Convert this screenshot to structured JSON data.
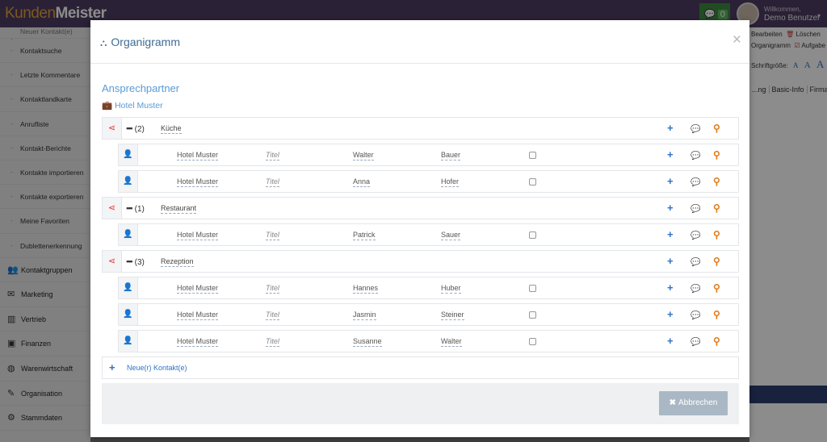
{
  "app": {
    "logo_a": "Kunden",
    "logo_b": "Meister",
    "chat_count": "0",
    "welcome": "Willkommen,",
    "user": "Demo Benutzer",
    "caret": "▾"
  },
  "sidebar": {
    "cut_item": "Neuer Kontakt(e)",
    "sub_items": [
      {
        "label": "Kontaktsuche"
      },
      {
        "label": "Letzte Kommentare"
      },
      {
        "label": "Kontaktlandkarte"
      },
      {
        "label": "Anrufliste"
      },
      {
        "label": "Kontakt-Berichte"
      },
      {
        "label": "Kontakte importieren"
      },
      {
        "label": "Kontakte exportieren"
      },
      {
        "label": "Meine Favoriten"
      },
      {
        "label": "Dublettenerkennung"
      }
    ],
    "main_items": [
      {
        "label": "Kontaktgruppen",
        "icon": "users-icon",
        "glyph": "👥"
      },
      {
        "label": "Marketing",
        "icon": "envelope-icon",
        "glyph": "✉"
      },
      {
        "label": "Vertrieb",
        "icon": "bar-chart-icon",
        "glyph": "▥"
      },
      {
        "label": "Finanzen",
        "icon": "money-icon",
        "glyph": "▣"
      },
      {
        "label": "Warenwirtschaft",
        "icon": "globe-icon",
        "glyph": "◍"
      },
      {
        "label": "Organisation",
        "icon": "edit-icon",
        "glyph": "✎"
      },
      {
        "label": "Stammdaten",
        "icon": "cogs-icon",
        "glyph": "⚙"
      }
    ]
  },
  "right_panel": {
    "bearbeiten": "Bearbeiten",
    "loeschen": "Löschen",
    "organigramm": "Organigramm",
    "aufgaben": "Aufgabe",
    "schriftgroesse": "Schriftgröße:",
    "font_sizes": [
      "A",
      "A",
      "A"
    ],
    "tabs": [
      "...ng",
      "Basic-Info",
      "Firma"
    ]
  },
  "modal": {
    "title": "Organigramm",
    "title_icon": "sitemap-icon",
    "close": "×",
    "section_title": "Ansprechpartner",
    "company": "Hotel Muster",
    "company_icon": "briefcase-icon",
    "new_contact": "Neue(r) Kontakt(e)",
    "cancel": "Abbrechen",
    "groups": [
      {
        "count": "(2)",
        "name": "Küche",
        "contacts": [
          {
            "company": "Hotel Muster",
            "title": "Titel",
            "first": "Walter",
            "last": "Bauer"
          },
          {
            "company": "Hotel Muster",
            "title": "Titel",
            "first": "Anna",
            "last": "Hofer"
          }
        ]
      },
      {
        "count": "(1)",
        "name": "Restaurant",
        "contacts": [
          {
            "company": "Hotel Muster",
            "title": "Titel",
            "first": "Patrick",
            "last": "Sauer"
          }
        ]
      },
      {
        "count": "(3)",
        "name": "Rezeption",
        "contacts": [
          {
            "company": "Hotel Muster",
            "title": "Titel",
            "first": "Hannes",
            "last": "Huber"
          },
          {
            "company": "Hotel Muster",
            "title": "Titel",
            "first": "Jasmin",
            "last": "Steiner"
          },
          {
            "company": "Hotel Muster",
            "title": "Titel",
            "first": "Susanne",
            "last": "Walter"
          }
        ]
      }
    ]
  },
  "colors": {
    "topbar": "#4d3d63",
    "accent_blue": "#2f73c4",
    "share_red": "#e33333",
    "search_orange": "#e07b1a",
    "title_blue": "#3d6c94"
  }
}
